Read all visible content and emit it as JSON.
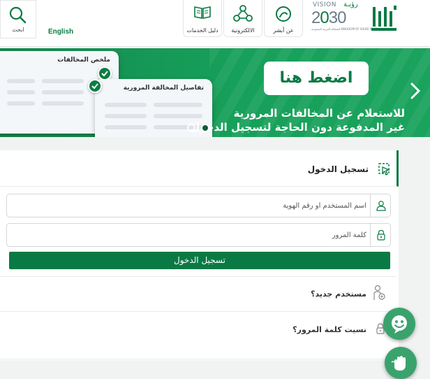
{
  "header": {
    "search_label": "ابحث",
    "language_label": "English",
    "buttons": [
      {
        "label": "دليل الخدمات",
        "icon": "book-icon"
      },
      {
        "label": "الالكترونية",
        "icon": "network-icon"
      },
      {
        "label": "عن أبشر",
        "icon": "absher-info-icon"
      }
    ],
    "vision": {
      "title": "VISION",
      "arabic": "رؤيـة",
      "year": "2030",
      "subtitle": "المملكة العربية السعودية KINGDOM OF SAUDI ARABIA"
    }
  },
  "banner": {
    "cta_label": "اضغط هنا",
    "line1": "للاستعلام عن المخالفات المرورية",
    "line2": "غير المدفوعة دون الحاجة لتسجيل الدخول",
    "card_back_title": "ملخص المخالفات",
    "card_front_title": "تفاصيل المخالفة المرورية",
    "active_slide": 2,
    "slide_count": 2
  },
  "login": {
    "title": "تسجيل الدخول",
    "username_placeholder": "اسم المستخدم أو رقم الهوية",
    "password_placeholder": "كلمة المرور",
    "submit_label": "تسجيل الدخول",
    "new_user_label": "مستخدم جديد؟",
    "forgot_password_label": "نسيت كلمة المرور؟"
  },
  "colors": {
    "brand_green": "#0a7a44",
    "banner_green": "#17a05a",
    "accent_green": "#3aa36d"
  },
  "floating": [
    {
      "icon": "chatbot-icon"
    },
    {
      "icon": "sign-language-icon"
    }
  ]
}
